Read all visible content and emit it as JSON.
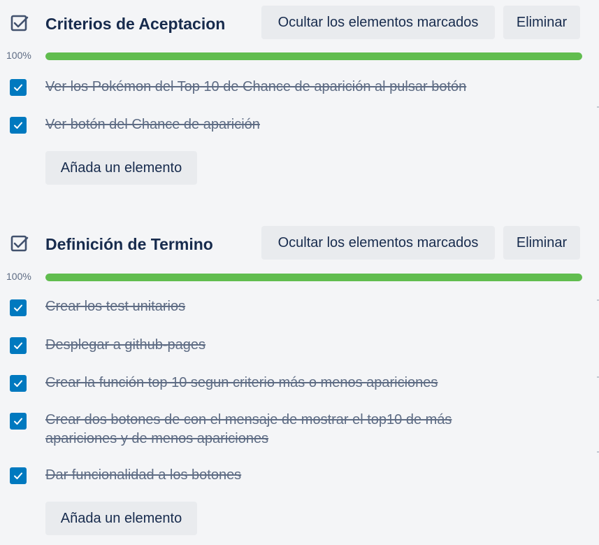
{
  "checklists": [
    {
      "title": "Criterios de Aceptacion",
      "hide_checked_label": "Ocultar los elementos marcados",
      "delete_label": "Eliminar",
      "progress_label": "100%",
      "progress": 1.0,
      "items": [
        {
          "text": "Ver los Pokémon del Top 10 de Chance de aparición al pulsar botón",
          "checked": true
        },
        {
          "text": "Ver botón del Chance de aparición",
          "checked": true
        }
      ],
      "add_item_label": "Añada un elemento"
    },
    {
      "title": "Definición de Termino",
      "hide_checked_label": "Ocultar los elementos marcados",
      "delete_label": "Eliminar",
      "progress_label": "100%",
      "progress": 1.0,
      "items": [
        {
          "text": "Crear los test unitarios",
          "checked": true
        },
        {
          "text": "Desplegar a github-pages",
          "checked": true
        },
        {
          "text": "Crear la función top 10 segun criterio más o menos apariciones",
          "checked": true
        },
        {
          "text": "Crear dos botones de con el mensaje de mostrar el top10 de más apariciones y de menos apariciones",
          "checked": true
        },
        {
          "text": "Dar funcionalidad a los botones",
          "checked": true
        }
      ],
      "add_item_label": "Añada un elemento"
    }
  ],
  "colors": {
    "progress_fill": "#61bd4f",
    "checkbox": "#0079bf",
    "button_bg": "#e9ebee"
  },
  "icons": {
    "checklist": "checklist-icon",
    "checkmark": "checkmark-icon"
  }
}
